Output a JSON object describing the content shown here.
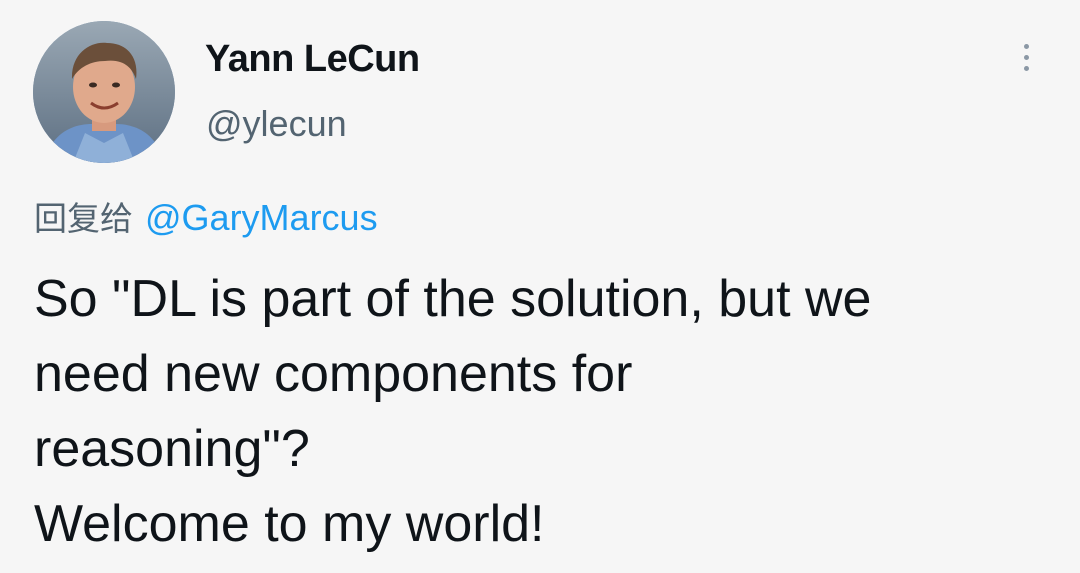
{
  "author": {
    "display_name": "Yann LeCun",
    "handle": "@ylecun"
  },
  "menu": {
    "icon": "more-vertical-icon"
  },
  "reply": {
    "prefix": "回复给",
    "mention": "@GaryMarcus"
  },
  "tweet": {
    "lines": [
      "So \"DL is part of the solution, but we",
      "need new components for",
      "reasoning\"?",
      "Welcome to my world!"
    ]
  },
  "colors": {
    "background": "#f6f6f6",
    "text": "#0f1419",
    "secondary": "#536471",
    "link": "#1d9bf0"
  }
}
